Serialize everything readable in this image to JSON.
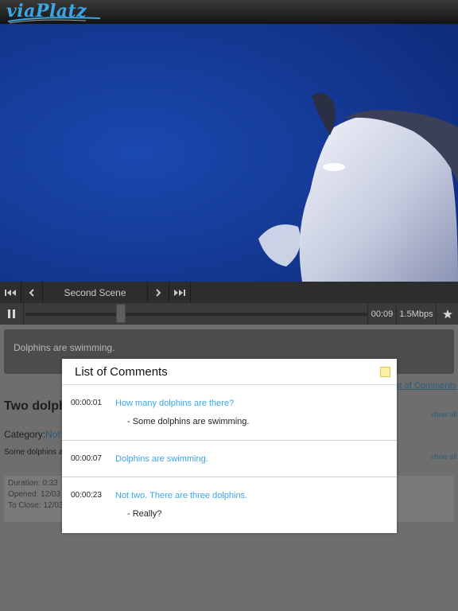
{
  "app": {
    "logo_text": "viaPlatz"
  },
  "video": {
    "subject": "dolphin swimming underwater"
  },
  "scene_nav": {
    "first_icon": "skip-to-start-icon",
    "prev_icon": "chevron-left-icon",
    "scene_label": "Second Scene",
    "next_icon": "chevron-right-icon",
    "last_icon": "skip-to-end-icon"
  },
  "player": {
    "pause_icon": "pause-icon",
    "time": "00:09",
    "bitrate": "1.5Mbps",
    "favorite_icon": "star-icon",
    "progress_fraction": 0.28
  },
  "comment_input": {
    "value": "Dolphins are swimming."
  },
  "list_link": "st of Comments",
  "video_info": {
    "title": "Two dolph",
    "category_label": "Category:",
    "category_value": "Not",
    "description": "Some dolphins a",
    "show_all_1": "show all",
    "show_all_2": "show all",
    "duration": "Duration: 0:33",
    "opened": "Opened: 12/03",
    "to_close": "To Close: 12/03"
  },
  "modal": {
    "title": "List of Comments",
    "comments": [
      {
        "time": "00:00:01",
        "text": "How many dolphins are there?",
        "reply": "- Some dolphins are swimming."
      },
      {
        "time": "00:00:07",
        "text": "Dolphins are swimming.",
        "reply": ""
      },
      {
        "time": "00:00:23",
        "text": "Not two. There are three dolphins.",
        "reply": "- Really?"
      }
    ]
  },
  "colors": {
    "accent": "#3aa6e6",
    "video_bg": "#11368f",
    "overlay": "#6e6e6e"
  }
}
